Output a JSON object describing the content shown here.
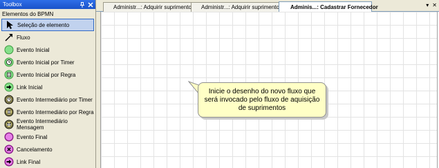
{
  "toolbox": {
    "title": "Toolbox",
    "pin_glyph": "📌",
    "close_glyph": "✕",
    "category": "Elementos do BPMN",
    "items": [
      {
        "label": "Seleção de elemento",
        "icon": "pointer-icon",
        "selected": true
      },
      {
        "label": "Fluxo",
        "icon": "flow-arrow-icon"
      },
      {
        "label": "Evento Inicial",
        "icon": "start-event-icon"
      },
      {
        "label": "Evento Inicial por Timer",
        "icon": "timer-start-event-icon"
      },
      {
        "label": "Evento Inicial por Regra",
        "icon": "rule-start-event-icon"
      },
      {
        "label": "Link Inicial",
        "icon": "link-start-icon"
      },
      {
        "label": "Evento Intermediário por Timer",
        "icon": "timer-intermediate-event-icon"
      },
      {
        "label": "Evento Intermediário por Regra",
        "icon": "rule-intermediate-event-icon"
      },
      {
        "label": "Evento Intermediário Mensagem",
        "icon": "message-intermediate-event-icon"
      },
      {
        "label": "Evento Final",
        "icon": "end-event-icon"
      },
      {
        "label": "Cancelamento",
        "icon": "cancel-event-icon"
      },
      {
        "label": "Link Final",
        "icon": "link-end-icon"
      }
    ]
  },
  "tabs": [
    {
      "label": "Administr...: Adquirir suprimentos",
      "active": false
    },
    {
      "label": "Administr...: Adquirir suprimentos",
      "active": false
    },
    {
      "label": "Adminis...: Cadastrar Fornecedor",
      "active": true
    }
  ],
  "strip_controls": {
    "dropdown": "▾",
    "close": "✕"
  },
  "canvas": {
    "note_text": "Inicie o desenho do novo fluxo que será invocado pelo fluxo de aquisição de suprimentos"
  },
  "colors": {
    "start_event": "#86e08a",
    "intermediate_event": "#f0e68c",
    "end_event": "#e780e7",
    "note_fill": "#ffffc6",
    "selection": "#c1d2ee"
  }
}
